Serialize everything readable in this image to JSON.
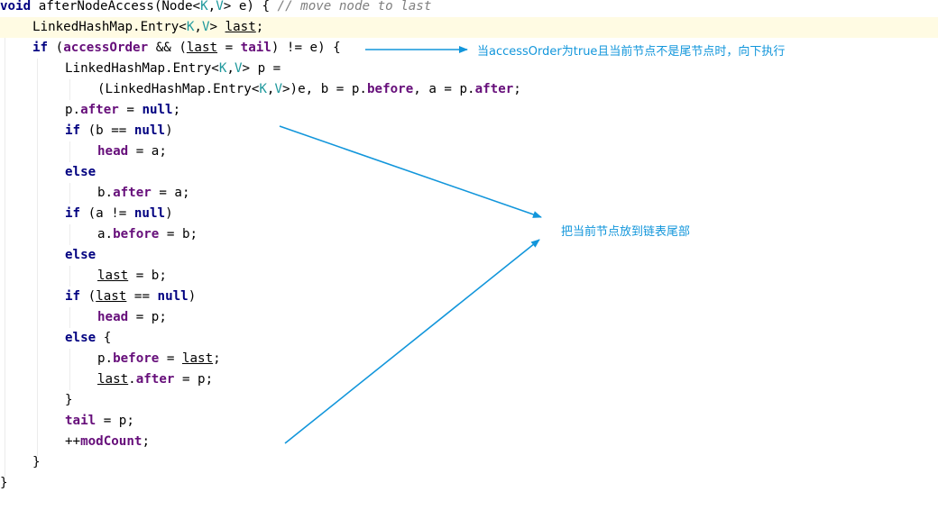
{
  "code": {
    "lines": [
      {
        "indent": 0,
        "tokens": [
          {
            "t": "void",
            "c": "kw"
          },
          {
            "t": " afterNodeAccess(Node<"
          },
          {
            "t": "K",
            "c": "tp"
          },
          {
            "t": ","
          },
          {
            "t": "V",
            "c": "tp"
          },
          {
            "t": "> e) { "
          },
          {
            "t": "// move node to last",
            "c": "cm"
          }
        ]
      },
      {
        "indent": 1,
        "highlight": true,
        "tokens": [
          {
            "t": "LinkedHashMap.Entry<"
          },
          {
            "t": "K",
            "c": "tp"
          },
          {
            "t": ","
          },
          {
            "t": "V",
            "c": "tp"
          },
          {
            "t": "> "
          },
          {
            "t": "last",
            "c": "ul"
          },
          {
            "t": ";"
          }
        ]
      },
      {
        "indent": 1,
        "tokens": [
          {
            "t": "if",
            "c": "kw"
          },
          {
            "t": " ("
          },
          {
            "t": "accessOrder",
            "c": "fld"
          },
          {
            "t": " && ("
          },
          {
            "t": "last",
            "c": "ul"
          },
          {
            "t": " = "
          },
          {
            "t": "tail",
            "c": "fld"
          },
          {
            "t": ") != e) {"
          }
        ]
      },
      {
        "indent": 2,
        "tokens": [
          {
            "t": "LinkedHashMap.Entry<"
          },
          {
            "t": "K",
            "c": "tp"
          },
          {
            "t": ","
          },
          {
            "t": "V",
            "c": "tp"
          },
          {
            "t": "> p ="
          }
        ]
      },
      {
        "indent": 3,
        "tokens": [
          {
            "t": "(LinkedHashMap.Entry<"
          },
          {
            "t": "K",
            "c": "tp"
          },
          {
            "t": ","
          },
          {
            "t": "V",
            "c": "tp"
          },
          {
            "t": ">)e, b = p."
          },
          {
            "t": "before",
            "c": "fld"
          },
          {
            "t": ", a = p."
          },
          {
            "t": "after",
            "c": "fld"
          },
          {
            "t": ";"
          }
        ]
      },
      {
        "indent": 2,
        "tokens": [
          {
            "t": "p."
          },
          {
            "t": "after",
            "c": "fld"
          },
          {
            "t": " = "
          },
          {
            "t": "null",
            "c": "kw"
          },
          {
            "t": ";"
          }
        ]
      },
      {
        "indent": 2,
        "tokens": [
          {
            "t": "if",
            "c": "kw"
          },
          {
            "t": " (b == "
          },
          {
            "t": "null",
            "c": "kw"
          },
          {
            "t": ")"
          }
        ]
      },
      {
        "indent": 3,
        "tokens": [
          {
            "t": "head",
            "c": "fld"
          },
          {
            "t": " = a;"
          }
        ]
      },
      {
        "indent": 2,
        "tokens": [
          {
            "t": "else",
            "c": "kw"
          }
        ]
      },
      {
        "indent": 3,
        "tokens": [
          {
            "t": "b."
          },
          {
            "t": "after",
            "c": "fld"
          },
          {
            "t": " = a;"
          }
        ]
      },
      {
        "indent": 2,
        "tokens": [
          {
            "t": "if",
            "c": "kw"
          },
          {
            "t": " (a != "
          },
          {
            "t": "null",
            "c": "kw"
          },
          {
            "t": ")"
          }
        ]
      },
      {
        "indent": 3,
        "tokens": [
          {
            "t": "a."
          },
          {
            "t": "before",
            "c": "fld"
          },
          {
            "t": " = b;"
          }
        ]
      },
      {
        "indent": 2,
        "tokens": [
          {
            "t": "else",
            "c": "kw"
          }
        ]
      },
      {
        "indent": 3,
        "tokens": [
          {
            "t": "last",
            "c": "ul"
          },
          {
            "t": " = b;"
          }
        ]
      },
      {
        "indent": 2,
        "tokens": [
          {
            "t": "if",
            "c": "kw"
          },
          {
            "t": " ("
          },
          {
            "t": "last",
            "c": "ul"
          },
          {
            "t": " == "
          },
          {
            "t": "null",
            "c": "kw"
          },
          {
            "t": ")"
          }
        ]
      },
      {
        "indent": 3,
        "tokens": [
          {
            "t": "head",
            "c": "fld"
          },
          {
            "t": " = p;"
          }
        ]
      },
      {
        "indent": 2,
        "tokens": [
          {
            "t": "else",
            "c": "kw"
          },
          {
            "t": " {"
          }
        ]
      },
      {
        "indent": 3,
        "tokens": [
          {
            "t": "p."
          },
          {
            "t": "before",
            "c": "fld"
          },
          {
            "t": " = "
          },
          {
            "t": "last",
            "c": "ul"
          },
          {
            "t": ";"
          }
        ]
      },
      {
        "indent": 3,
        "tokens": [
          {
            "t": "last",
            "c": "ul"
          },
          {
            "t": "."
          },
          {
            "t": "after",
            "c": "fld"
          },
          {
            "t": " = p;"
          }
        ]
      },
      {
        "indent": 2,
        "tokens": [
          {
            "t": "}"
          }
        ]
      },
      {
        "indent": 2,
        "tokens": [
          {
            "t": "tail",
            "c": "fld"
          },
          {
            "t": " = p;"
          }
        ]
      },
      {
        "indent": 2,
        "tokens": [
          {
            "t": "++"
          },
          {
            "t": "modCount",
            "c": "fld"
          },
          {
            "t": ";"
          }
        ]
      },
      {
        "indent": 1,
        "tokens": [
          {
            "t": "}"
          }
        ]
      },
      {
        "indent": 0,
        "tokens": [
          {
            "t": "}"
          }
        ]
      }
    ]
  },
  "annotations": {
    "note1": "当accessOrder为true且当前节点不是尾节点时，向下执行",
    "note2": "把当前节点放到链表尾部"
  },
  "colors": {
    "keyword": "#000080",
    "field": "#660e7a",
    "type_param": "#20999d",
    "comment": "#808080",
    "annotation": "#1296db",
    "line_highlight": "#fffbe3"
  }
}
